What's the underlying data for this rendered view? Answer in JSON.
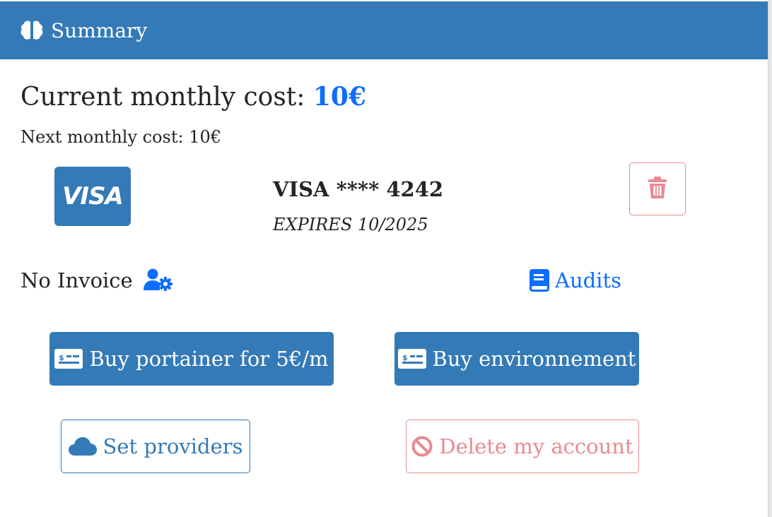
{
  "header": {
    "title": "Summary",
    "icon": "brain-icon"
  },
  "cost": {
    "current_label": "Current monthly cost: ",
    "current_value": "10€",
    "next_label": "Next monthly cost: 10€"
  },
  "card": {
    "brand_logo_text": "VISA",
    "number": "VISA **** 4242",
    "expiry": "EXPIRES 10/2025",
    "delete_icon": "trash-icon"
  },
  "invoice": {
    "text": "No Invoice",
    "icon": "user-gear-icon"
  },
  "audits": {
    "label": "Audits",
    "icon": "book-icon"
  },
  "buttons": {
    "buy_portainer": "Buy portainer for 5€/m",
    "buy_environment": "Buy environnement",
    "set_providers": "Set providers",
    "delete_account": "Delete my account"
  },
  "colors": {
    "primary": "#337ab7",
    "link": "#0d6efd",
    "danger_outline": "#e88a90"
  }
}
